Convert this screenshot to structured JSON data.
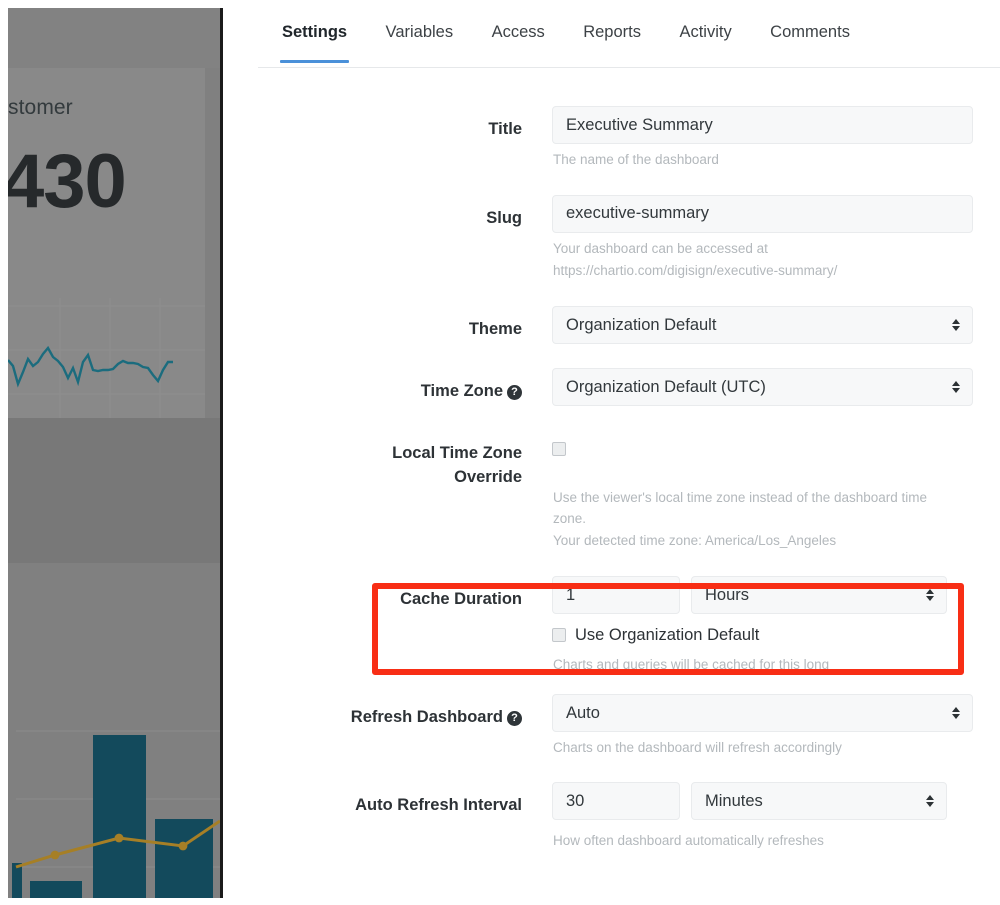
{
  "backdrop": {
    "kpi_title": "stomer",
    "kpi_value": "430",
    "sparkline_color": "#1b6c7e",
    "bar_color": "#134a5c",
    "line_color": "#a67f26",
    "overlay_color": "#808080"
  },
  "tabs": [
    {
      "label": "Settings",
      "active": true
    },
    {
      "label": "Variables",
      "active": false
    },
    {
      "label": "Access",
      "active": false
    },
    {
      "label": "Reports",
      "active": false
    },
    {
      "label": "Activity",
      "active": false
    },
    {
      "label": "Comments",
      "active": false
    }
  ],
  "form": {
    "title": {
      "label": "Title",
      "value": "Executive Summary",
      "hint": "The name of the dashboard"
    },
    "slug": {
      "label": "Slug",
      "value": "executive-summary",
      "hint_line1": "Your dashboard can be accessed at",
      "hint_line2": "https://chartio.com/digisign/executive-summary/"
    },
    "theme": {
      "label": "Theme",
      "value": "Organization Default",
      "options": [
        "Organization Default"
      ]
    },
    "time_zone": {
      "label": "Time Zone",
      "help": "?",
      "value": "Organization Default (UTC)",
      "options": [
        "Organization Default (UTC)"
      ]
    },
    "local_time_zone_override": {
      "label_line1": "Local Time Zone",
      "label_line2": "Override",
      "checked": false,
      "hint_line1": "Use the viewer's local time zone instead of the dashboard time",
      "hint_line2": "zone.",
      "hint_line3": "Your detected time zone: America/Los_Angeles"
    },
    "cache_duration": {
      "label": "Cache Duration",
      "amount": "1",
      "unit": "Hours",
      "unit_options": [
        "Hours"
      ],
      "use_org_default_label": "Use Organization Default",
      "use_org_default_checked": false,
      "hint": "Charts and queries will be cached for this long",
      "highlighted": true,
      "highlight_color": "#f82e15"
    },
    "refresh_dashboard": {
      "label": "Refresh Dashboard",
      "help": "?",
      "value": "Auto",
      "options": [
        "Auto"
      ],
      "hint": "Charts on the dashboard will refresh accordingly"
    },
    "auto_refresh_interval": {
      "label": "Auto Refresh Interval",
      "amount": "30",
      "unit": "Minutes",
      "unit_options": [
        "Minutes"
      ],
      "hint": "How often dashboard automatically refreshes"
    }
  },
  "theme_colors": {
    "accent_blue": "#4a90d9",
    "field_bg": "#f7f8f9",
    "hint_text": "#b3b8bc",
    "label_text": "#2d3236"
  }
}
